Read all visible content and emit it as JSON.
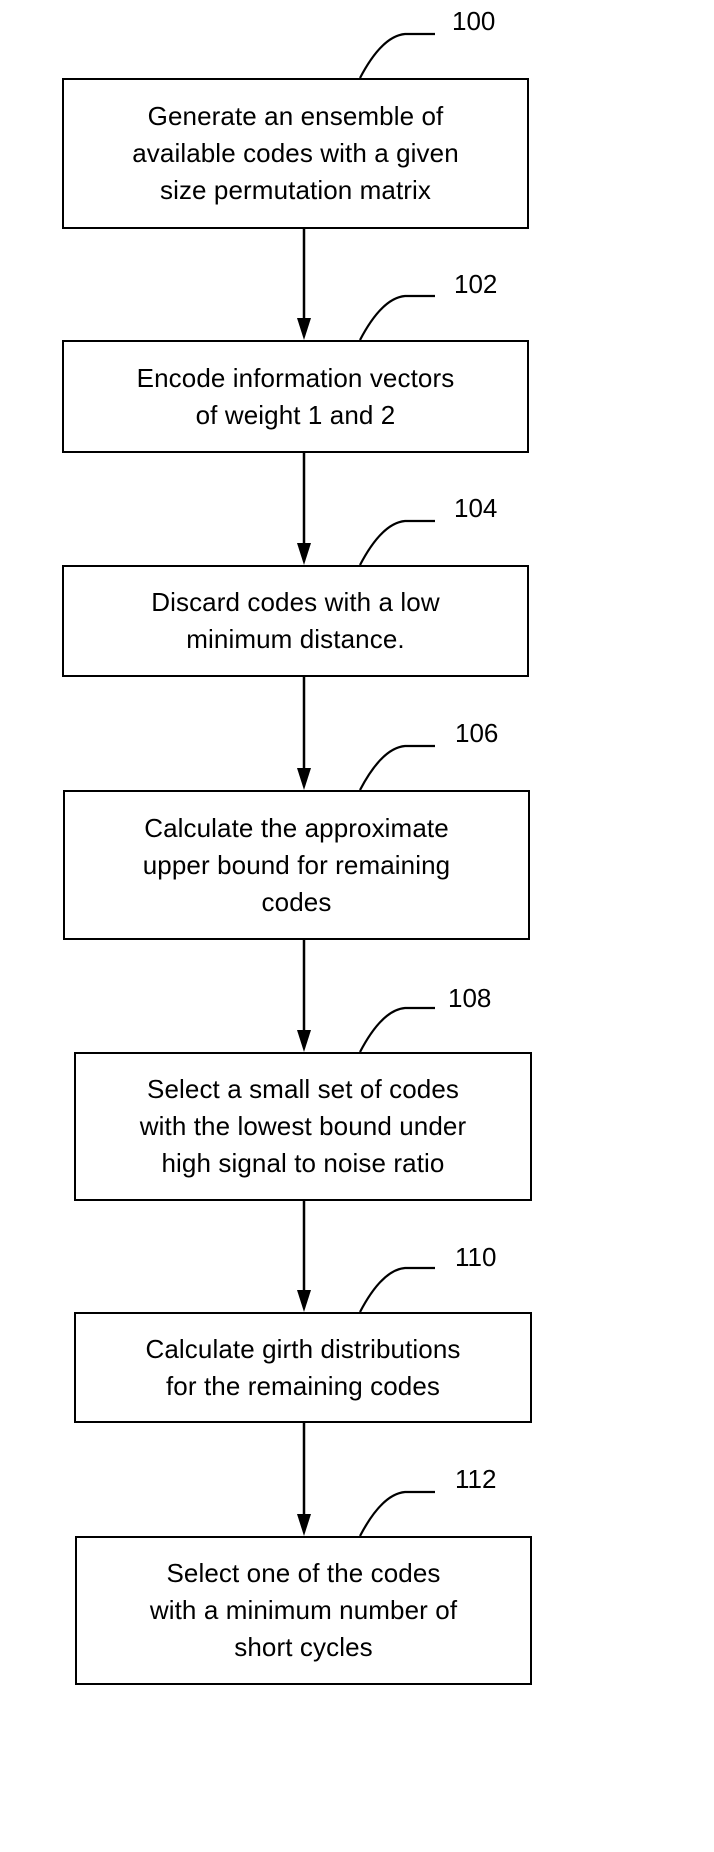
{
  "figure": {
    "type": "flowchart",
    "steps": [
      {
        "ref": "100",
        "text": "Generate an ensemble of\navailable codes with a given\nsize permutation matrix"
      },
      {
        "ref": "102",
        "text": "Encode information vectors\nof weight 1 and 2"
      },
      {
        "ref": "104",
        "text": "Discard codes with a low\nminimum distance."
      },
      {
        "ref": "106",
        "text": "Calculate the approximate\nupper bound for remaining\ncodes"
      },
      {
        "ref": "108",
        "text": "Select a small set of codes\nwith the lowest bound under\nhigh signal to noise ratio"
      },
      {
        "ref": "110",
        "text": "Calculate girth distributions\nfor the remaining codes"
      },
      {
        "ref": "112",
        "text": "Select one of the codes\nwith a minimum number of\nshort cycles"
      }
    ],
    "edges": [
      {
        "from": "100",
        "to": "102"
      },
      {
        "from": "102",
        "to": "104"
      },
      {
        "from": "104",
        "to": "106"
      },
      {
        "from": "106",
        "to": "108"
      },
      {
        "from": "108",
        "to": "110"
      },
      {
        "from": "110",
        "to": "112"
      }
    ],
    "line_color": "#000000",
    "background_color": "#ffffff"
  }
}
